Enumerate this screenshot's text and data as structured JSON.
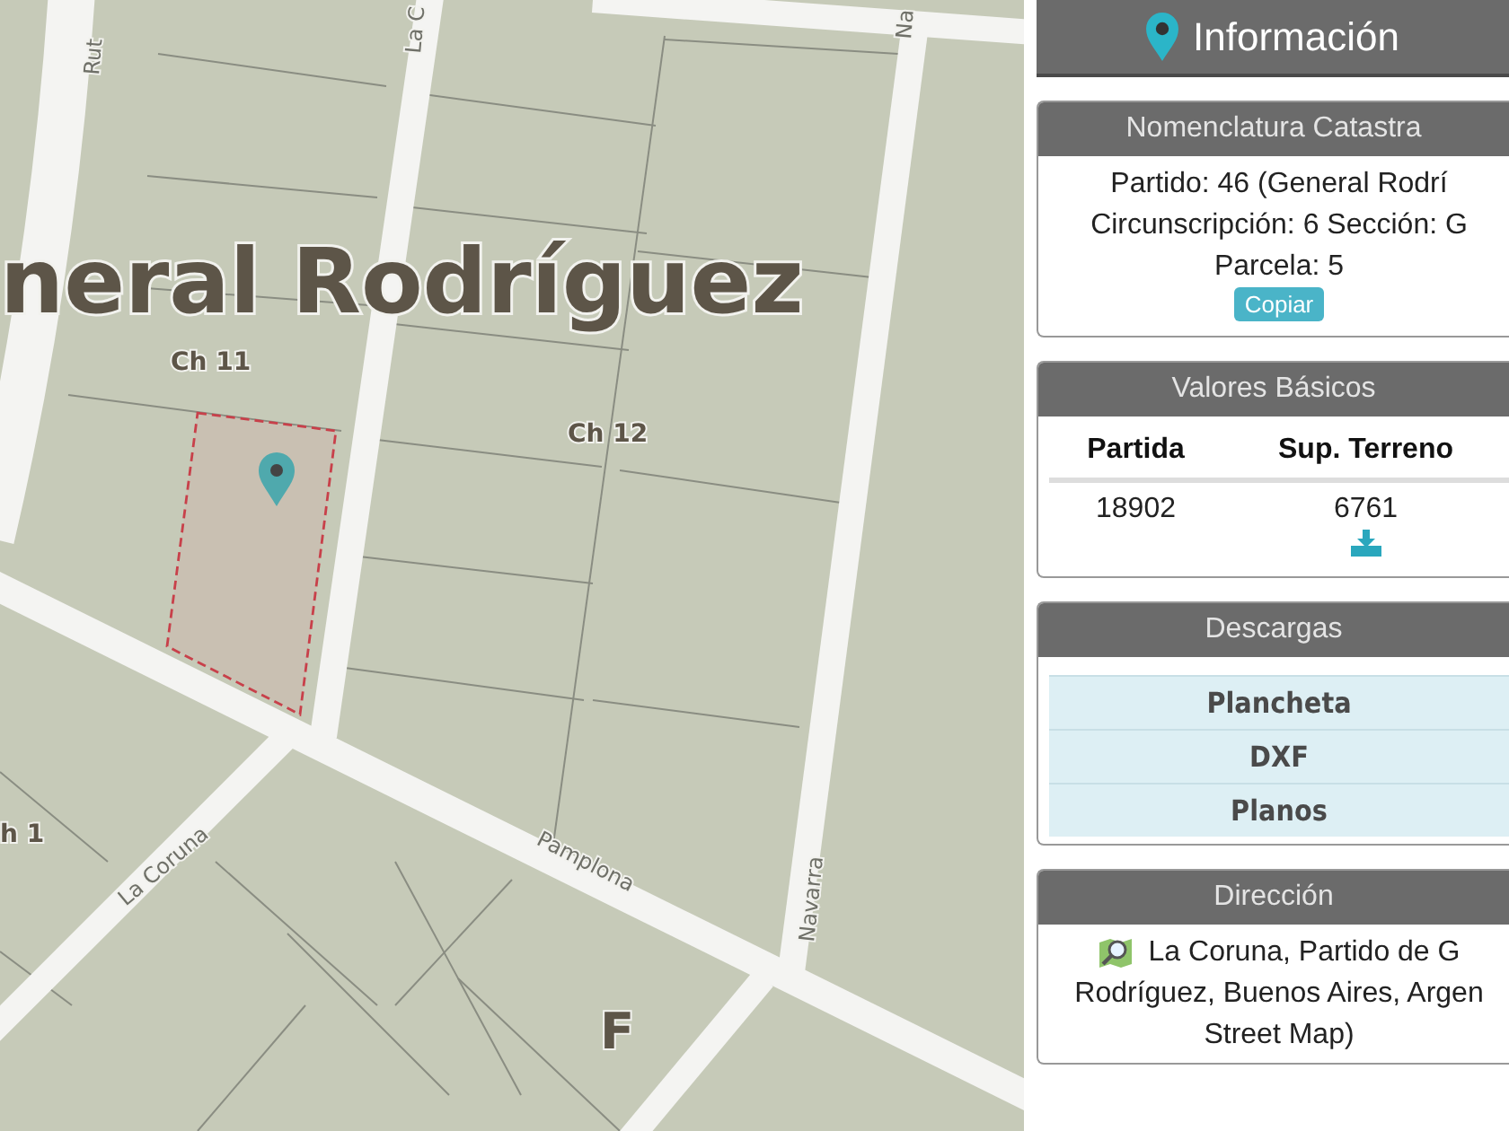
{
  "map": {
    "labels": [
      {
        "text": "neral Rodríguez",
        "kind": "town"
      },
      {
        "text": "Ch 11",
        "kind": "block"
      },
      {
        "text": "Ch 12",
        "kind": "block"
      },
      {
        "text": "h 1",
        "kind": "block"
      },
      {
        "text": "F",
        "kind": "sector"
      },
      {
        "text": "Rut",
        "kind": "street"
      },
      {
        "text": "La C",
        "kind": "street"
      },
      {
        "text": "Na",
        "kind": "street"
      },
      {
        "text": "La Coruna",
        "kind": "street"
      },
      {
        "text": "Pamplona",
        "kind": "street"
      },
      {
        "text": "Navarra",
        "kind": "street"
      }
    ]
  },
  "info": {
    "title": "Información"
  },
  "nomenclatura": {
    "title": "Nomenclatura Catastra",
    "lines": [
      "Partido: 46 (General Rodrí",
      "Circunscripción: 6 Sección: G",
      "Parcela: 5"
    ],
    "button": "Copiar"
  },
  "valores": {
    "title": "Valores Básicos",
    "columns": [
      "Partida",
      "Sup. Terreno"
    ],
    "rows": [
      [
        "18902",
        "6761"
      ]
    ]
  },
  "descargas": {
    "title": "Descargas",
    "items": [
      "Plancheta",
      "DXF",
      "Planos"
    ]
  },
  "direccion": {
    "title": "Dirección",
    "lines": [
      "La Coruna, Partido de G",
      "Rodríguez, Buenos Aires, Argen",
      "Street Map)"
    ]
  }
}
